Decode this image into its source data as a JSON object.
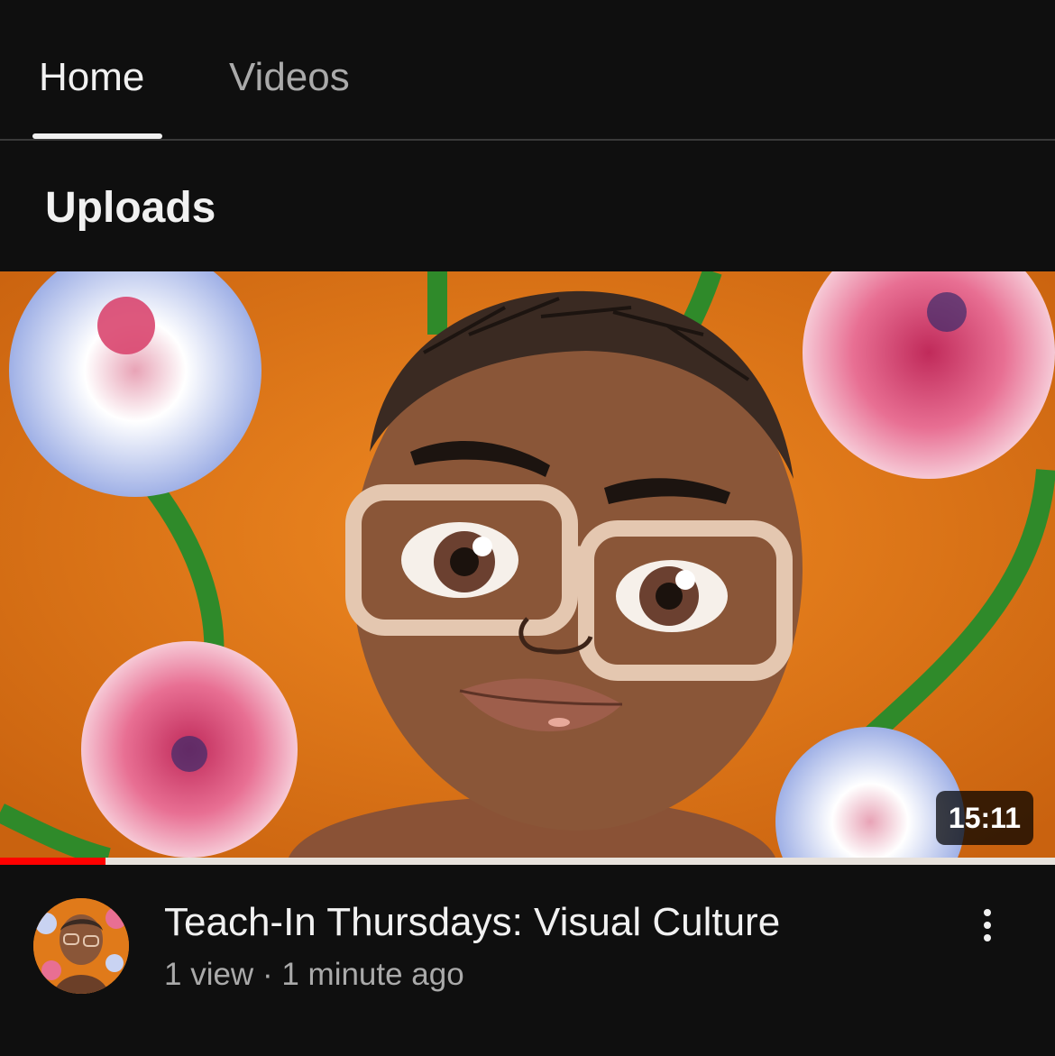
{
  "tabs": [
    {
      "label": "Home",
      "selected": true
    },
    {
      "label": "Videos",
      "selected": false
    }
  ],
  "section": {
    "title": "Uploads"
  },
  "video": {
    "title": "Teach-In Thursdays: Visual Culture",
    "views": "1 view",
    "separator": "·",
    "age": "1 minute ago",
    "duration": "15:11",
    "watched_fraction": 0.1,
    "thumbnail_icon": "cartoon-portrait-with-flowers-thumbnail",
    "avatar_icon": "channel-avatar-icon",
    "menu_icon": "more-vertical-icon"
  },
  "colors": {
    "background": "#0f0f0f",
    "progress": "#ff0000",
    "thumbnail_bg": "#e07a1a"
  }
}
